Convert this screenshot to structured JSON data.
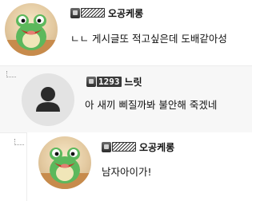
{
  "comments": [
    {
      "nickname": "오공케롱",
      "level": "",
      "text": "ㄴㄴ 게시글또 적고싶은데 도배같아성",
      "avatar": "frog-icon"
    },
    {
      "nickname": "느릿",
      "level": "1293",
      "text": "아 새끼 삐질까봐 불안해 죽겠네",
      "avatar": "user-icon"
    },
    {
      "nickname": "오공케롱",
      "level": "",
      "text": "남자아이가!",
      "avatar": "frog-icon"
    }
  ],
  "colors": {
    "frog_green": "#5cb85c",
    "badge_dark": "#3a3a3a",
    "reply_bg": "#f7f7f7"
  }
}
